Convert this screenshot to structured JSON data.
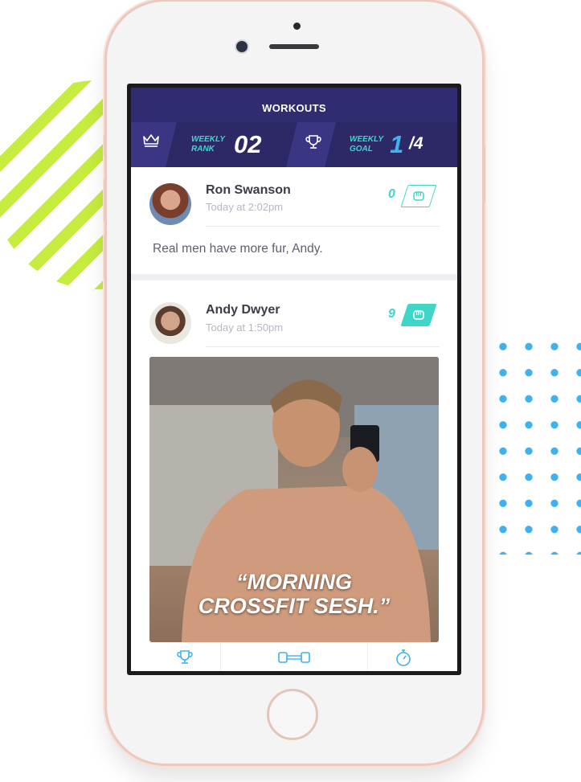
{
  "header": {
    "title": "WORKOUTS",
    "rank_label_1": "WEEKLY",
    "rank_label_2": "RANK",
    "rank_value": "02",
    "goal_label_1": "WEEKLY",
    "goal_label_2": "GOAL",
    "goal_value": "1",
    "goal_total": "/4",
    "crown_icon": "crown-icon",
    "trophy_icon": "trophy-icon"
  },
  "posts": [
    {
      "author": "Ron Swanson",
      "time": "Today at 2:02pm",
      "fist_count": "0",
      "text": "Real men have more fur, Andy."
    },
    {
      "author": "Andy Dwyer",
      "time": "Today at 1:50pm",
      "fist_count": "9",
      "caption_line1": "“MORNING",
      "caption_line2": "CROSSFIT SESH.”"
    }
  ],
  "actions": [
    "trophy-icon",
    "dumbbell-icon",
    "stopwatch-icon"
  ],
  "colors": {
    "header_bg": "#2f2c72",
    "accent_teal": "#3fd6c8",
    "accent_lime": "#c6ec3f",
    "accent_blue": "#3fb2ee"
  }
}
